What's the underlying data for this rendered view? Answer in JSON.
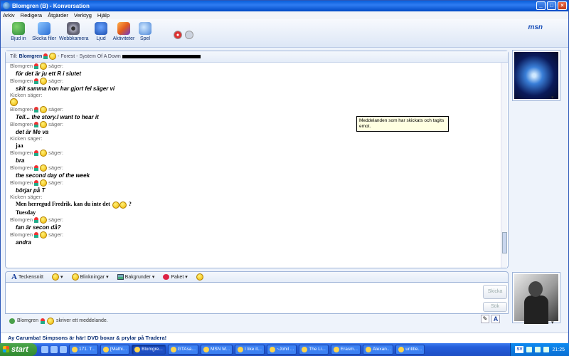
{
  "window": {
    "title": "Blomgren (B) - Konversation"
  },
  "menu": [
    "Arkiv",
    "Redigera",
    "Åtgärder",
    "Verktyg",
    "Hjälp"
  ],
  "toolbar": {
    "items": [
      {
        "label": "Bjud in",
        "icon": "invite-icon"
      },
      {
        "label": "Skicka filer",
        "icon": "send-files-icon"
      },
      {
        "label": "Webbkamera",
        "icon": "webcam-icon"
      },
      {
        "label": "Ljud",
        "icon": "audio-icon"
      },
      {
        "label": "Aktiviteter",
        "icon": "activities-icon"
      },
      {
        "label": "Spel",
        "icon": "games-icon"
      }
    ],
    "logo": "msn"
  },
  "conversation": {
    "to_label": "Till:",
    "to_name": "Blomgren",
    "to_status": "- Forest - System Of A Down",
    "messages": [
      {
        "sender": "Blomgren",
        "says": "säger:",
        "text": "för det är ju ett R i slutet",
        "style": "italic"
      },
      {
        "sender": "Blomgren",
        "says": "säger:",
        "text": "skit samma hon har gjort fel säger vi",
        "style": "italic"
      },
      {
        "sender": "Kicken säger:",
        "says": "",
        "text": "",
        "style": "emoticon"
      },
      {
        "sender": "Blomgren",
        "says": "säger:",
        "text": "Tell... the story.I want to hear it",
        "style": "italic"
      },
      {
        "sender": "Blomgren",
        "says": "säger:",
        "text": "det är Me va",
        "style": "italic"
      },
      {
        "sender": "Kicken säger:",
        "says": "",
        "text": "jaa",
        "style": "plain"
      },
      {
        "sender": "Blomgren",
        "says": "säger:",
        "text": "bra",
        "style": "italic"
      },
      {
        "sender": "Blomgren",
        "says": "säger:",
        "text": "the second day of the week",
        "style": "italic"
      },
      {
        "sender": "Blomgren",
        "says": "säger:",
        "text": "börjar på T",
        "style": "italic"
      },
      {
        "sender": "Kicken säger:",
        "says": "",
        "text": "Men herregud Fredrik. kan du inte det",
        "style": "plain",
        "suffix": "?"
      },
      {
        "sender": "",
        "says": "",
        "text": "Tuesday",
        "style": "plain"
      },
      {
        "sender": "Blomgren",
        "says": "säger:",
        "text": "fan är secon då?",
        "style": "italic"
      },
      {
        "sender": "Blomgren",
        "says": "säger:",
        "text": "andra",
        "style": "italic"
      }
    ],
    "tooltip": "Meddelanden som har skickats och tagits emot."
  },
  "format": {
    "font": "Teckensnitt",
    "winks": "Blinkningar",
    "backgrounds": "Bakgrunder",
    "packs": "Paket"
  },
  "compose": {
    "send": "Skicka",
    "search": "Sök",
    "status_name": "Blomgren",
    "status_text": "skriver ett meddelande."
  },
  "ad": "Ay Carumba! Simpsons är här! DVD boxar & prylar på Tradera!",
  "taskbar": {
    "start": "start",
    "tasks": [
      "171. T...",
      "[Mathi...",
      "Blomgre...",
      "GTAsa...",
      "MSN M...",
      "I like it...",
      "~Johil ...",
      "The Li...",
      "Erasm...",
      "Alexan...",
      "untitle..."
    ],
    "active_index": 2,
    "tray_lang": "SV",
    "clock": "21:25"
  },
  "colors": {
    "accent": "#0b2f75",
    "title_blue": "#0a5fdb"
  }
}
